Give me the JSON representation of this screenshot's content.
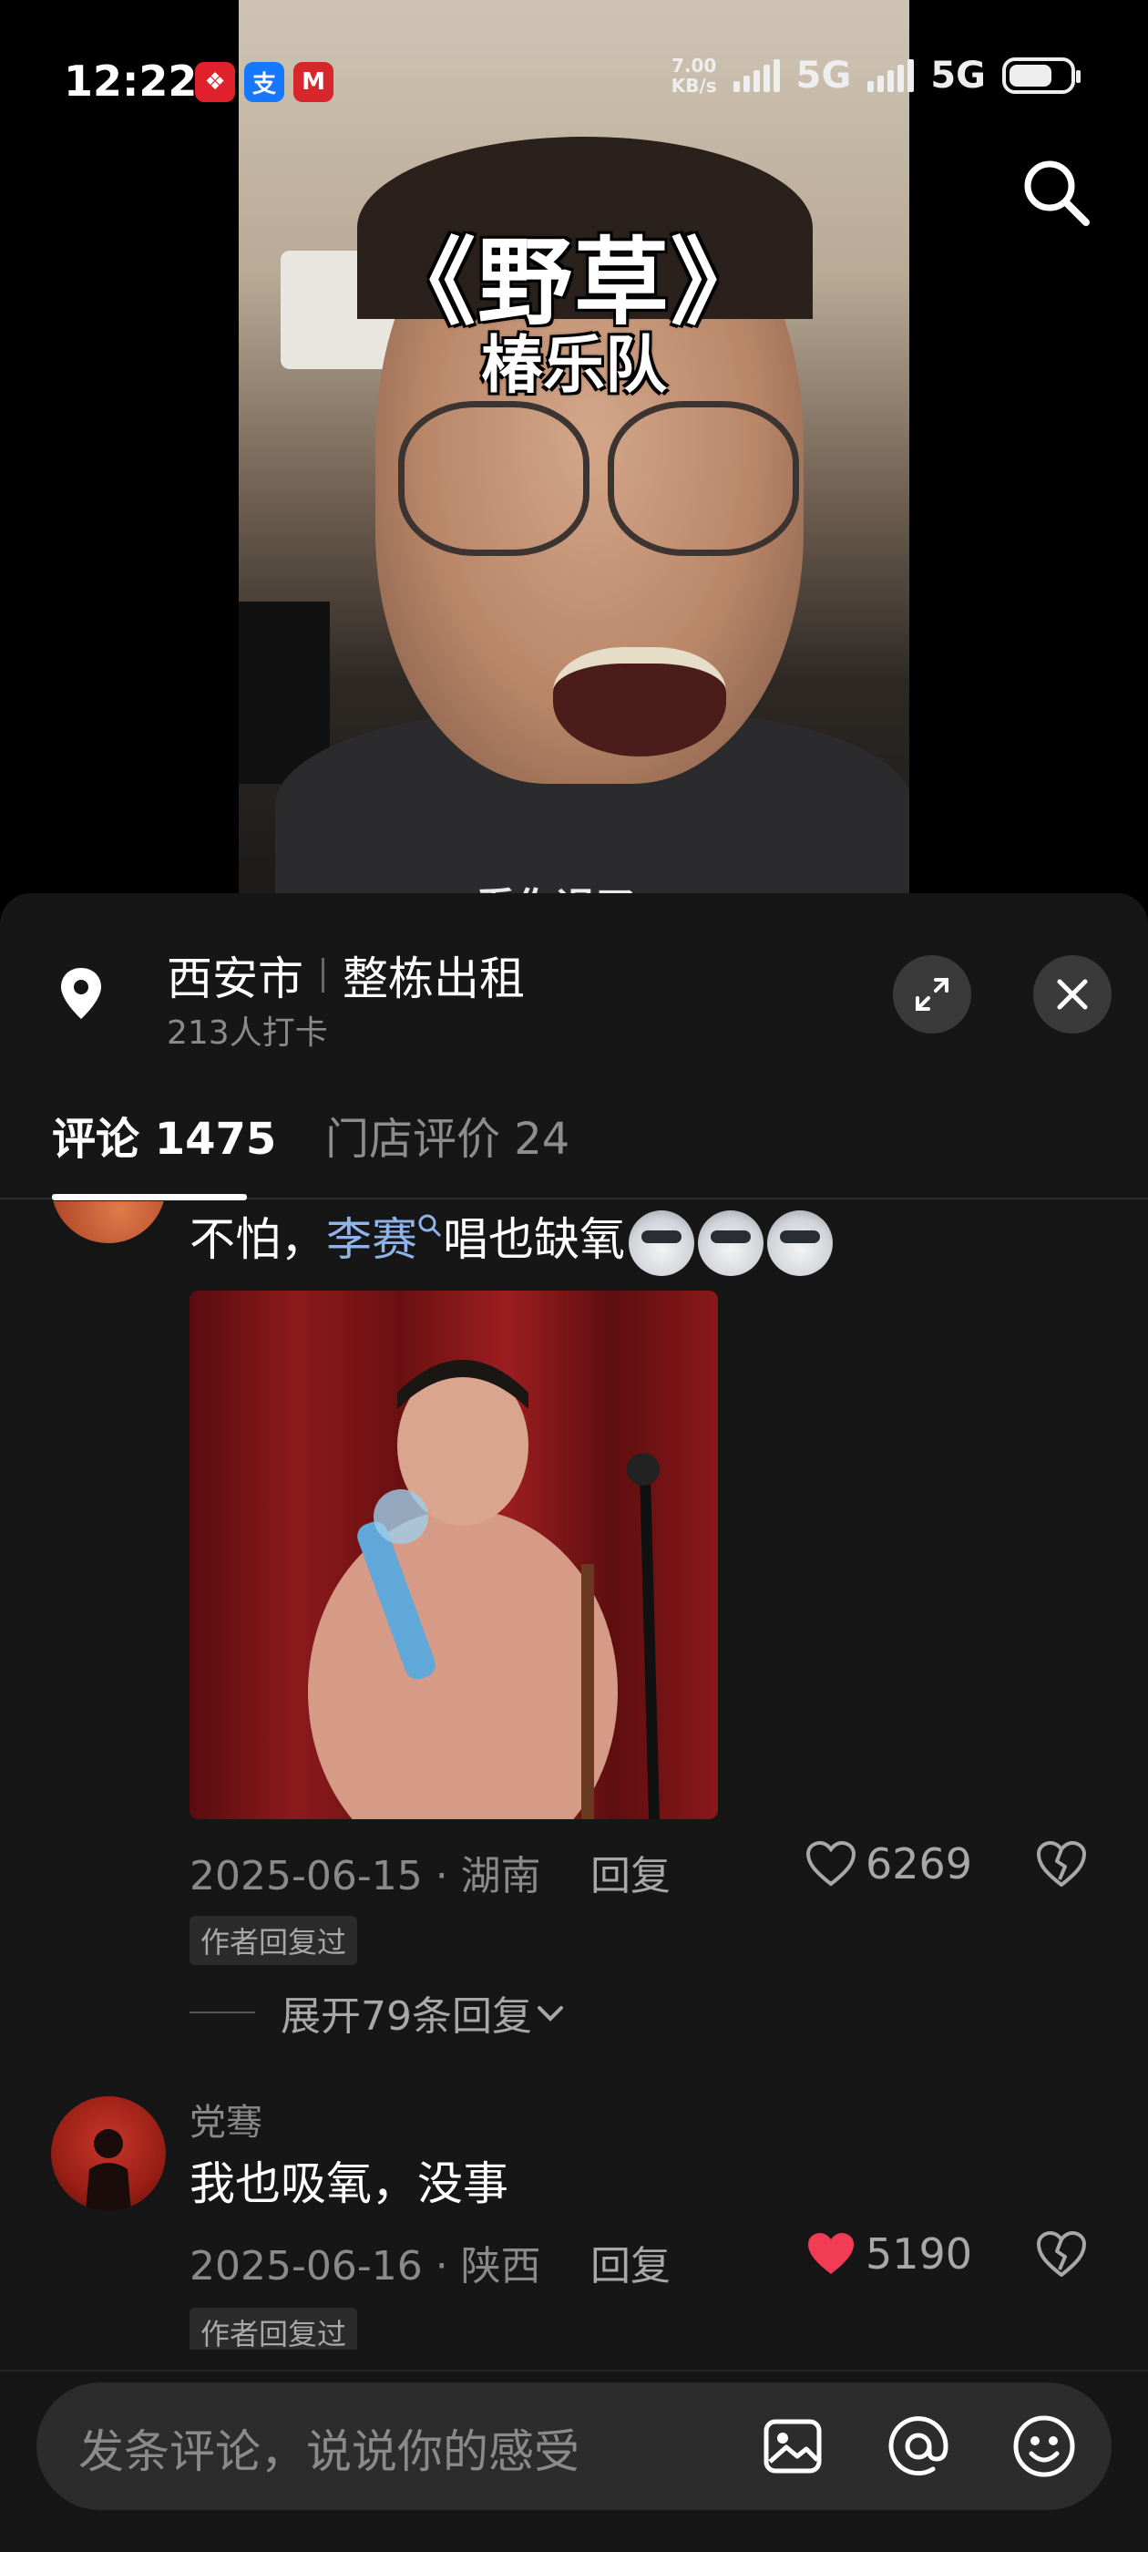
{
  "status_bar": {
    "time": "12:22",
    "apps": [
      "红包",
      "支",
      "M"
    ],
    "net_speed_value": "7.00",
    "net_speed_unit": "KB/s",
    "network_1": "5G",
    "network_2": "5G"
  },
  "video": {
    "title": "《野草》",
    "subtitle": "椿乐队",
    "caption_partial": "看你退了"
  },
  "location": {
    "city": "西安市",
    "name": "整栋出租",
    "checkins": "213人打卡"
  },
  "tabs": {
    "comments": "评论 1475",
    "store_reviews": "门店评价 24"
  },
  "comments": [
    {
      "text_before": "不怕，",
      "mention": "李赛",
      "text_after": "唱也缺氧",
      "emoji": [
        "husky-emoji",
        "husky-emoji",
        "husky-emoji"
      ],
      "date_region": "2025-06-15 · 湖南",
      "reply_label": "回复",
      "likes": "6269",
      "liked": false,
      "author_replied": "作者回复过",
      "expand_label": "展开79条回复"
    },
    {
      "username": "党骞",
      "text": "我也吸氧，没事",
      "date_region": "2025-06-16 · 陕西",
      "reply_label": "回复",
      "likes": "5190",
      "liked": true,
      "author_replied": "作者回复过"
    }
  ],
  "input": {
    "placeholder": "发条评论，说说你的感受"
  },
  "colors": {
    "sheet_bg": "#161616",
    "mention": "#8fb4ea",
    "like_active": "#f23b55",
    "muted_text": "#8a8a8a"
  }
}
